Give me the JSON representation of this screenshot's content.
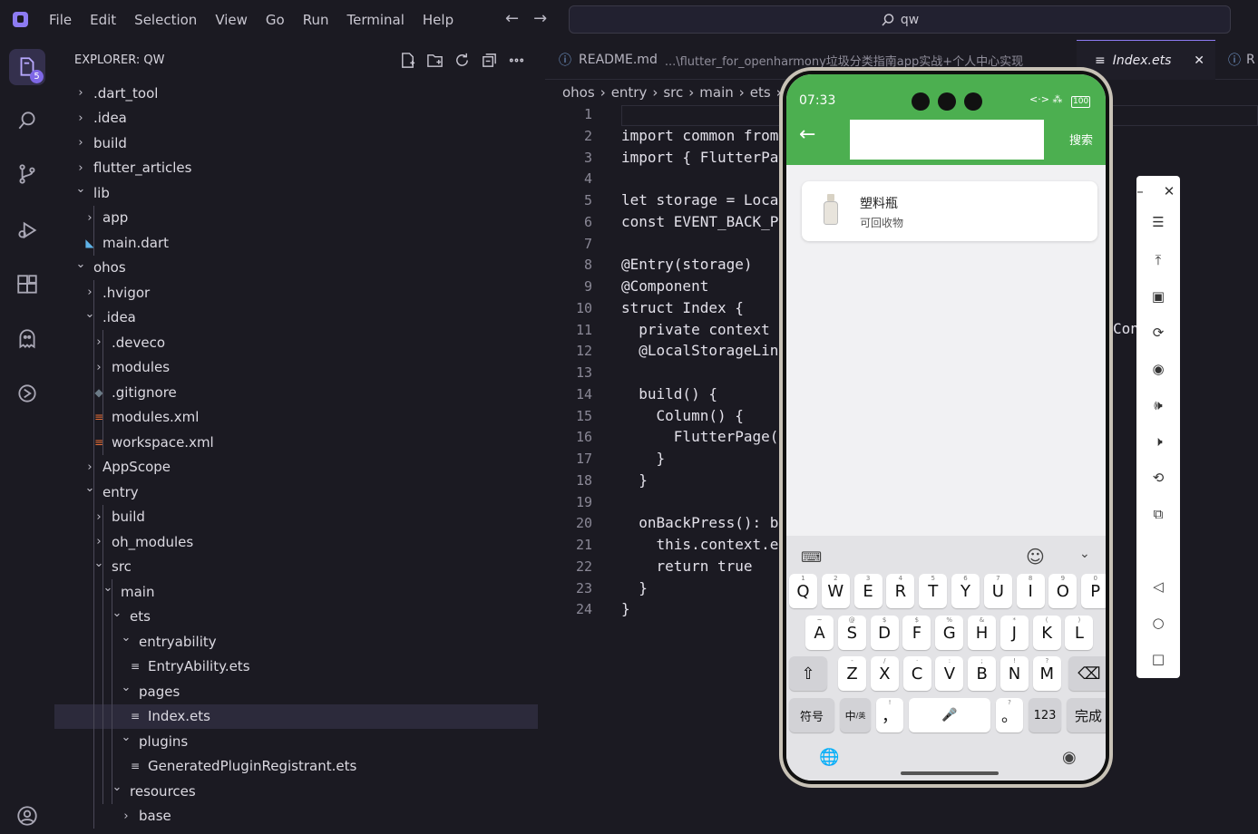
{
  "menu": [
    "File",
    "Edit",
    "Selection",
    "View",
    "Go",
    "Run",
    "Terminal",
    "Help"
  ],
  "search": {
    "text": "qw"
  },
  "explorer": {
    "title": "EXPLORER: QW",
    "items": [
      {
        "label": ".dart_tool",
        "type": "folder",
        "open": false,
        "depth": 0
      },
      {
        "label": ".idea",
        "type": "folder",
        "open": false,
        "depth": 0
      },
      {
        "label": "build",
        "type": "folder",
        "open": false,
        "depth": 0
      },
      {
        "label": "flutter_articles",
        "type": "folder",
        "open": false,
        "depth": 0
      },
      {
        "label": "lib",
        "type": "folder",
        "open": true,
        "depth": 0
      },
      {
        "label": "app",
        "type": "folder",
        "open": false,
        "depth": 1
      },
      {
        "label": "main.dart",
        "type": "dart",
        "depth": 1
      },
      {
        "label": "ohos",
        "type": "folder",
        "open": true,
        "depth": 0
      },
      {
        "label": ".hvigor",
        "type": "folder",
        "open": false,
        "depth": 1
      },
      {
        "label": ".idea",
        "type": "folder",
        "open": true,
        "depth": 1
      },
      {
        "label": ".deveco",
        "type": "folder",
        "open": false,
        "depth": 2
      },
      {
        "label": "modules",
        "type": "folder",
        "open": false,
        "depth": 2
      },
      {
        "label": ".gitignore",
        "type": "git",
        "depth": 2
      },
      {
        "label": "modules.xml",
        "type": "xml",
        "depth": 2
      },
      {
        "label": "workspace.xml",
        "type": "xml",
        "depth": 2
      },
      {
        "label": "AppScope",
        "type": "folder",
        "open": false,
        "depth": 1
      },
      {
        "label": "entry",
        "type": "folder",
        "open": true,
        "depth": 1
      },
      {
        "label": "build",
        "type": "folder",
        "open": false,
        "depth": 2
      },
      {
        "label": "oh_modules",
        "type": "folder",
        "open": false,
        "depth": 2
      },
      {
        "label": "src",
        "type": "folder",
        "open": true,
        "depth": 2
      },
      {
        "label": "main",
        "type": "folder",
        "open": true,
        "depth": 3
      },
      {
        "label": "ets",
        "type": "folder",
        "open": true,
        "depth": 4
      },
      {
        "label": "entryability",
        "type": "folder",
        "open": true,
        "depth": 5
      },
      {
        "label": "EntryAbility.ets",
        "type": "file",
        "depth": 6
      },
      {
        "label": "pages",
        "type": "folder",
        "open": true,
        "depth": 5
      },
      {
        "label": "Index.ets",
        "type": "file",
        "depth": 6,
        "selected": true
      },
      {
        "label": "plugins",
        "type": "folder",
        "open": true,
        "depth": 5
      },
      {
        "label": "GeneratedPluginRegistrant.ets",
        "type": "file",
        "depth": 6
      },
      {
        "label": "resources",
        "type": "folder",
        "open": true,
        "depth": 4
      },
      {
        "label": "base",
        "type": "folder",
        "open": false,
        "depth": 5
      }
    ]
  },
  "badge": "5",
  "tabs": [
    {
      "label": "README.md",
      "desc": "...\\flutter_for_openharmony垃圾分类指南app实战+个人中心实现"
    },
    {
      "label": "Index.ets",
      "close": "✕"
    },
    {
      "label": "R"
    }
  ],
  "breadcrumb": [
    "ohos",
    "entry",
    "src",
    "main",
    "ets"
  ],
  "code": [
    "",
    "import common from",
    "import { FlutterPa",
    "",
    "let storage = Loca",
    "const EVENT_BACK_P",
    "",
    "@Entry(storage)",
    "@Component",
    "struct Index {",
    "  private context",
    "  @LocalStorageLin",
    "",
    "  build() {",
    "    Column() {",
    "      FlutterPage(",
    "    }",
    "  }",
    "",
    "  onBackPress(): b",
    "    this.context.e",
    "    return true",
    "  }",
    "}"
  ],
  "code_overflow": "Con",
  "phone": {
    "time": "07:33",
    "battery": "100",
    "search_button": "搜索",
    "result": {
      "name": "塑料瓶",
      "category": "可回收物"
    },
    "keyboard": {
      "row1": [
        [
          "Q",
          "1"
        ],
        [
          "W",
          "2"
        ],
        [
          "E",
          "3"
        ],
        [
          "R",
          "4"
        ],
        [
          "T",
          "5"
        ],
        [
          "Y",
          "6"
        ],
        [
          "U",
          "7"
        ],
        [
          "I",
          "8"
        ],
        [
          "O",
          "9"
        ],
        [
          "P",
          "0"
        ]
      ],
      "row2": [
        [
          "A",
          "~"
        ],
        [
          "S",
          "@"
        ],
        [
          "D",
          "$"
        ],
        [
          "F",
          "$"
        ],
        [
          "G",
          "%"
        ],
        [
          "H",
          "&"
        ],
        [
          "J",
          "*"
        ],
        [
          "K",
          "("
        ],
        [
          "L",
          ")"
        ]
      ],
      "row3": [
        [
          "Z",
          "-"
        ],
        [
          "X",
          "/"
        ],
        [
          "C",
          "·"
        ],
        [
          "V",
          ":"
        ],
        [
          "B",
          ";"
        ],
        [
          "N",
          "!"
        ],
        [
          "M",
          "?"
        ]
      ],
      "symbols": "符号",
      "lang": "中",
      "lang_sub": "/英",
      "comma": "，",
      "comma_sup": "!",
      "period": "。",
      "period_sup": "?",
      "num": "123",
      "done": "完成"
    }
  },
  "colors": {
    "accent": "#8d7bf2",
    "app_green": "#4caf50"
  }
}
